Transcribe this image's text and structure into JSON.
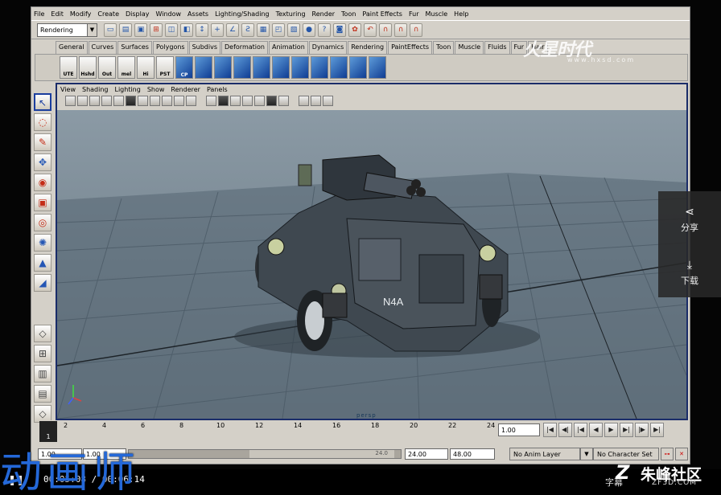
{
  "menubar": [
    "File",
    "Edit",
    "Modify",
    "Create",
    "Display",
    "Window",
    "Assets",
    "Lighting/Shading",
    "Texturing",
    "Render",
    "Toon",
    "Paint Effects",
    "Fur",
    "Muscle",
    "Help"
  ],
  "status_line": {
    "mode": "Rendering"
  },
  "shelf_tabs": [
    "General",
    "Curves",
    "Surfaces",
    "Polygons",
    "Subdivs",
    "Deformation",
    "Animation",
    "Dynamics",
    "Rendering",
    "PaintEffects",
    "Toon",
    "Muscle",
    "Fluids",
    "Fur",
    "Hair"
  ],
  "shelf_buttons": [
    "UTE",
    "Hshd",
    "Out",
    "mel",
    "Hi",
    "PST",
    "CP"
  ],
  "panel_menu": [
    "View",
    "Shading",
    "Lighting",
    "Show",
    "Renderer",
    "Panels"
  ],
  "viewport": {
    "camera": "persp",
    "model_decal": "N4A"
  },
  "time_slider": {
    "current_frame": "1",
    "ticks": [
      "2",
      "4",
      "6",
      "8",
      "10",
      "12",
      "14",
      "16",
      "18",
      "20",
      "22",
      "24"
    ],
    "frame_field": "1.00"
  },
  "range": {
    "start": "1.00",
    "inner_start": "1.00",
    "handle": "24.0",
    "end": "24.00",
    "outer_end": "48.00",
    "anim_layer": "No Anim Layer",
    "char_set": "No Character Set"
  },
  "watermark": {
    "title": "火星时代",
    "url": "www.hxsd.com"
  },
  "side_panel": {
    "share": "分享",
    "download": "下载"
  },
  "video": {
    "time": "00:05:08 / 00:06:14",
    "subtitle": "字幕"
  },
  "brand": {
    "left": "动画师",
    "right": "朱峰社区",
    "url": "ZF3D.COM"
  },
  "colors": {
    "viewport_bg": "#7c8b96",
    "panel_border": "#1a2c69",
    "brand_blue": "#2468d8"
  }
}
